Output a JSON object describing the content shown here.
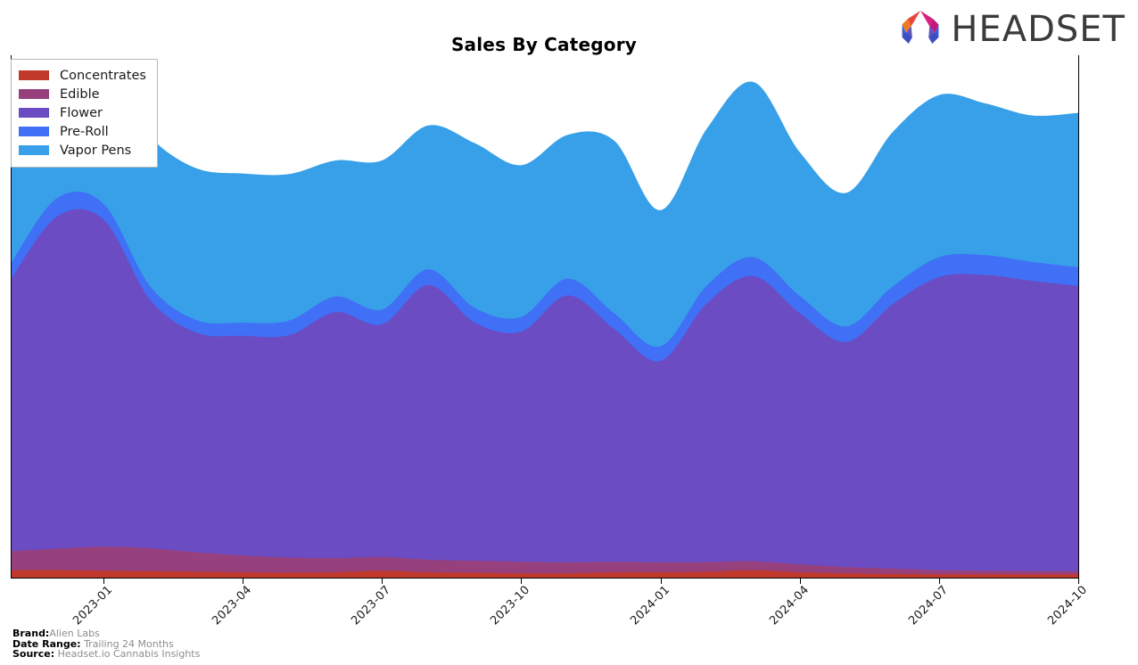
{
  "header": {
    "title": "Sales By Category",
    "logo_word": "HEADSET",
    "logo_mark_name": "headset-arch-logo"
  },
  "legend": {
    "position": "upper-left",
    "items": [
      {
        "label": "Concentrates",
        "color": "#C0392B"
      },
      {
        "label": "Edible",
        "color": "#96407E"
      },
      {
        "label": "Flower",
        "color": "#6B4CC2"
      },
      {
        "label": "Pre-Roll",
        "color": "#4070F5"
      },
      {
        "label": "Vapor Pens",
        "color": "#37A0E8"
      }
    ]
  },
  "footer": {
    "brand_key": "Brand:",
    "brand_value": "Alien Labs",
    "date_range_key": "Date Range:",
    "date_range_value": "Trailing 24 Months",
    "source_key": "Source:",
    "source_value": "Headset.io Cannabis Insights"
  },
  "chart_data": {
    "type": "area",
    "stacked": true,
    "interpolation": "smooth-spline",
    "title": "Sales By Category",
    "xlabel": "",
    "ylabel": "",
    "grid": false,
    "legend_position": "upper-left",
    "x": [
      "2022-11",
      "2022-12",
      "2023-01",
      "2023-02",
      "2023-03",
      "2023-04",
      "2023-05",
      "2023-06",
      "2023-07",
      "2023-08",
      "2023-09",
      "2023-10",
      "2023-11",
      "2023-12",
      "2024-01",
      "2024-02",
      "2024-03",
      "2024-04",
      "2024-05",
      "2024-06",
      "2024-07",
      "2024-08",
      "2024-09",
      "2024-10"
    ],
    "xtick_labels": [
      "2023-01",
      "2023-04",
      "2023-07",
      "2023-10",
      "2024-01",
      "2024-04",
      "2024-07",
      "2024-10"
    ],
    "ylim": [
      0,
      100
    ],
    "series": [
      {
        "name": "Concentrates",
        "color": "#C0392B",
        "values": [
          1.6,
          1.6,
          1.5,
          1.4,
          1.3,
          1.2,
          1.1,
          1.2,
          1.5,
          1.2,
          1.1,
          1.0,
          1.0,
          1.2,
          1.2,
          1.3,
          1.6,
          1.2,
          1.0,
          0.9,
          0.8,
          0.8,
          0.8,
          0.8
        ]
      },
      {
        "name": "Edible",
        "color": "#96407E",
        "values": [
          3.6,
          4.1,
          4.6,
          4.4,
          3.7,
          3.2,
          2.9,
          2.7,
          2.6,
          2.4,
          2.3,
          2.2,
          2.1,
          2.0,
          1.9,
          1.8,
          1.7,
          1.5,
          1.2,
          1.0,
          0.8,
          0.7,
          0.6,
          0.6
        ]
      },
      {
        "name": "Flower",
        "color": "#6B4CC2",
        "values": [
          52.0,
          63.5,
          62.5,
          47.5,
          42.0,
          42.0,
          42.5,
          47.0,
          44.5,
          52.5,
          45.5,
          44.0,
          51.0,
          44.5,
          38.5,
          49.5,
          54.5,
          48.0,
          43.0,
          50.5,
          56.0,
          56.5,
          55.5,
          54.5
        ]
      },
      {
        "name": "Pre-Roll",
        "color": "#4070F5",
        "values": [
          3.0,
          3.5,
          3.0,
          2.6,
          2.4,
          2.5,
          2.8,
          3.0,
          2.8,
          3.0,
          2.8,
          2.8,
          3.2,
          3.0,
          2.8,
          3.4,
          3.6,
          3.3,
          3.0,
          3.4,
          3.8,
          3.8,
          3.6,
          3.6
        ]
      },
      {
        "name": "Vapor Pens",
        "color": "#37A0E8",
        "values": [
          33.0,
          25.5,
          24.5,
          28.5,
          29.0,
          28.5,
          28.0,
          26.0,
          28.5,
          27.5,
          31.5,
          29.0,
          27.5,
          33.0,
          26.0,
          30.0,
          33.5,
          27.5,
          25.5,
          29.5,
          31.0,
          29.0,
          28.0,
          29.5
        ]
      }
    ]
  }
}
